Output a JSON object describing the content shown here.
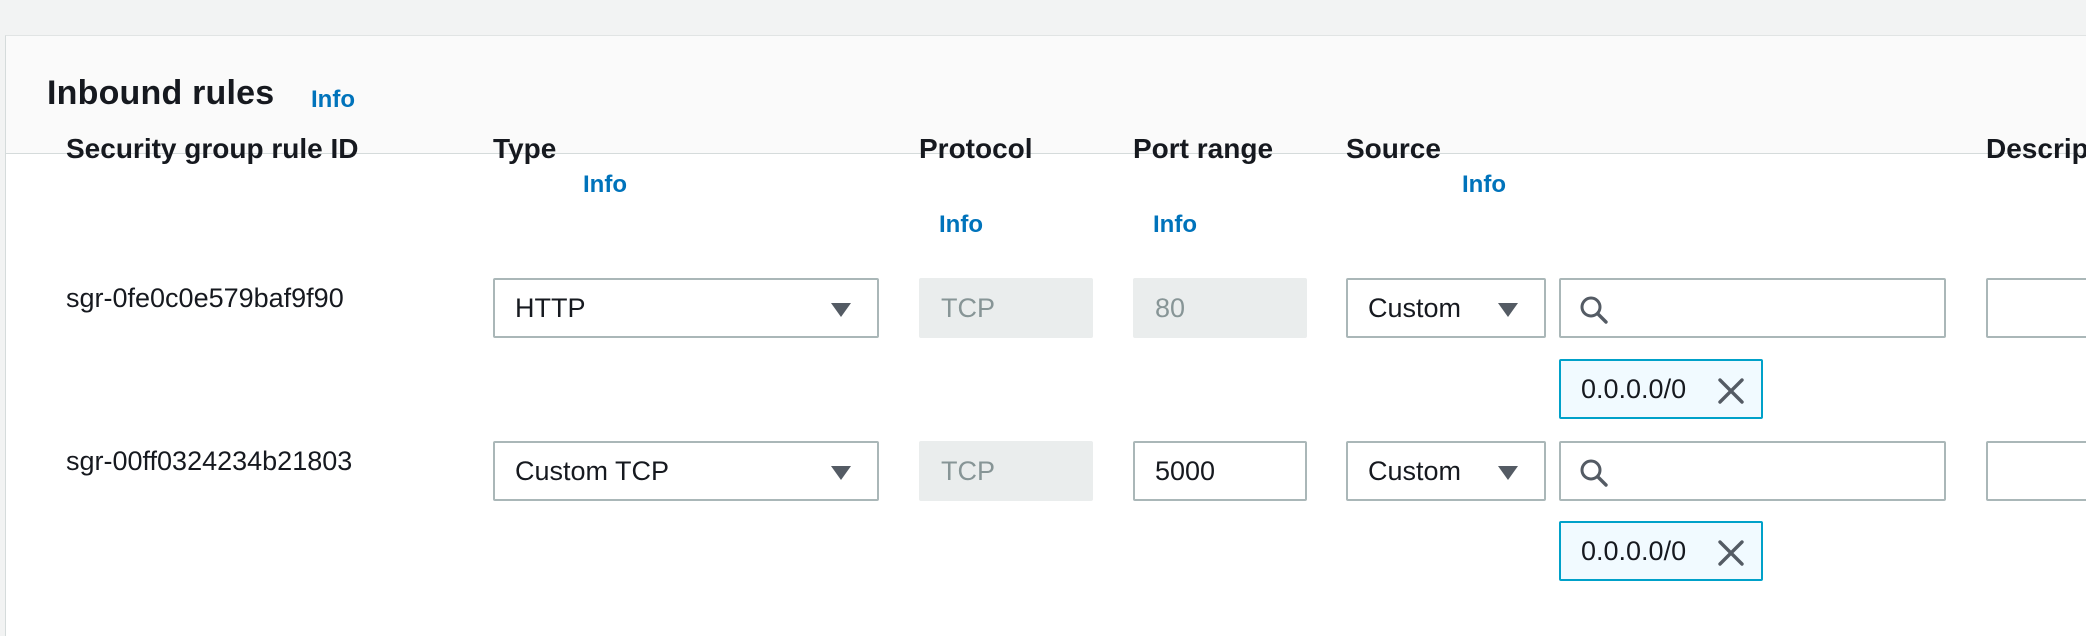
{
  "section": {
    "title": "Inbound rules",
    "info": "Info"
  },
  "columns": {
    "rule_id": "Security group rule ID",
    "type": "Type",
    "type_info": "Info",
    "protocol": "Protocol",
    "protocol_info": "Info",
    "port_range": "Port range",
    "port_range_info": "Info",
    "source": "Source",
    "source_info": "Info",
    "description": "Descript"
  },
  "rules": [
    {
      "id": "sgr-0fe0c0e579baf9f90",
      "type": "HTTP",
      "protocol": "TCP",
      "port_range": "80",
      "source_type": "Custom",
      "source_token": "0.0.0.0/0",
      "description": ""
    },
    {
      "id": "sgr-00ff0324234b21803",
      "type": "Custom TCP",
      "protocol": "TCP",
      "port_range": "5000",
      "source_type": "Custom",
      "source_token": "0.0.0.0/0",
      "description": ""
    }
  ],
  "icons": {
    "caret": "caret-down-icon",
    "search": "search-icon",
    "remove": "close-icon"
  },
  "colors": {
    "link": "#0073bb",
    "token_border": "#00a1c9",
    "token_bg": "#f1faff",
    "readonly_bg": "#eaeded"
  }
}
